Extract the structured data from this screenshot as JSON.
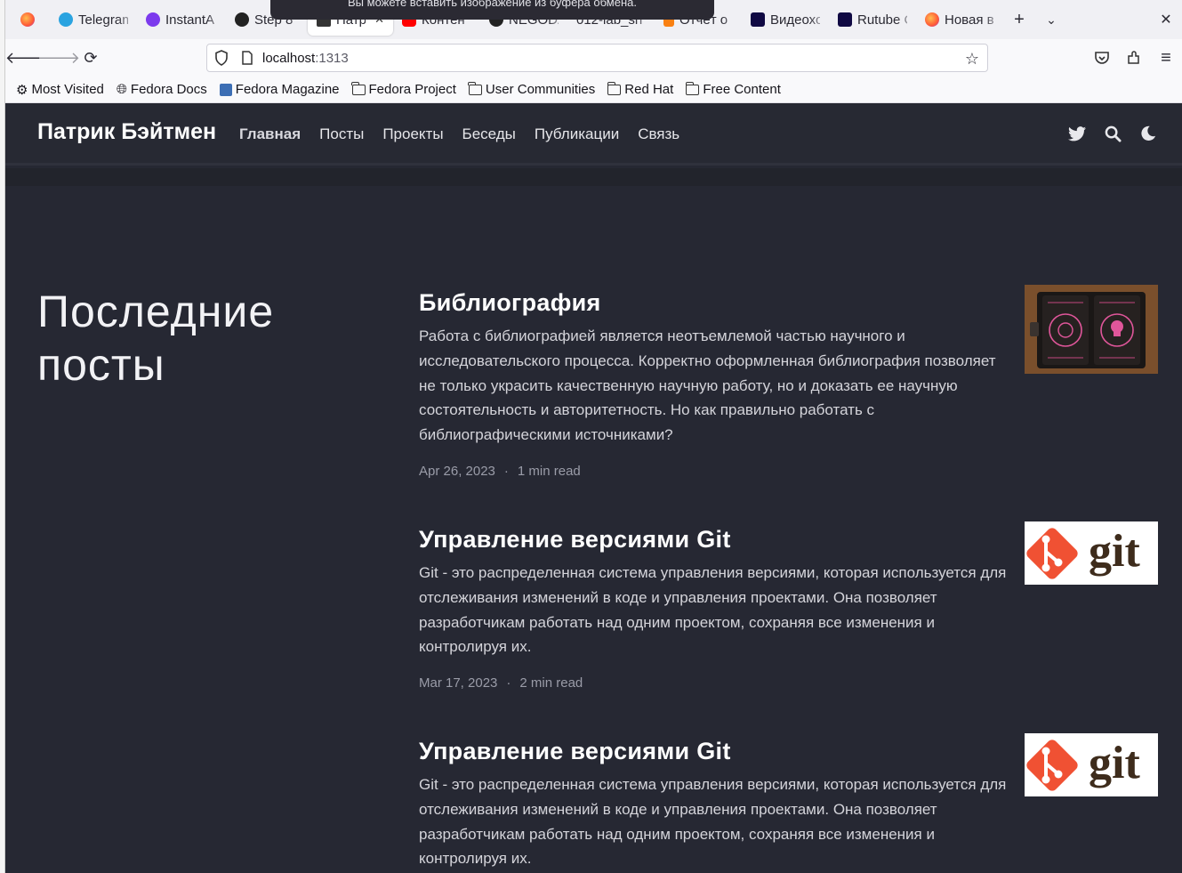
{
  "browser": {
    "tabs": [
      {
        "label": "",
        "icon": "firefox-icon"
      },
      {
        "label": "Telegram",
        "icon": "telegram-icon"
      },
      {
        "label": "InstantA",
        "icon": "instant-icon"
      },
      {
        "label": "Step 8",
        "icon": "step-icon"
      },
      {
        "label": "Патр",
        "icon": "page-icon",
        "active": true
      },
      {
        "label": "Контен",
        "icon": "youtube-icon"
      },
      {
        "label": "NEGODA",
        "icon": "github-icon"
      },
      {
        "label": "012-lab_sh",
        "icon": ""
      },
      {
        "label": "Отчёт о",
        "icon": "moodle-icon"
      },
      {
        "label": "Видеохо",
        "icon": "rutube-icon"
      },
      {
        "label": "Rutube С",
        "icon": "rutube-icon"
      },
      {
        "label": "Новая в",
        "icon": "firefox-icon"
      }
    ],
    "toast": "Вы можете вставить изображение из буфера обмена.",
    "url_host": "localhost",
    "url_port": ":1313",
    "bookmarks": [
      {
        "label": "Most Visited",
        "icon": "gear-icon"
      },
      {
        "label": "Fedora Docs",
        "icon": "globe-icon"
      },
      {
        "label": "Fedora Magazine",
        "icon": "fedora-magazine-icon"
      },
      {
        "label": "Fedora Project",
        "icon": "folder-icon"
      },
      {
        "label": "User Communities",
        "icon": "folder-icon"
      },
      {
        "label": "Red Hat",
        "icon": "folder-icon"
      },
      {
        "label": "Free Content",
        "icon": "folder-icon"
      }
    ]
  },
  "site": {
    "brand": "Патрик Бэйтмен",
    "menu": [
      "Главная",
      "Посты",
      "Проекты",
      "Беседы",
      "Публикации",
      "Связь"
    ],
    "active_menu": "Главная",
    "hero_title": "Последние посты",
    "posts": [
      {
        "title": "Библиография",
        "summary": "Работа с библиографией является неотъемлемой частью научного и исследовательского процесса. Корректно оформленная библиография позволяет не только украсить качественную научную работу, но и доказать ее научную состоятельность и авторитетность. Но как правильно работать с библиографическими источниками?",
        "date": "Apr 26, 2023",
        "read_time": "1 min read",
        "thumb": "book"
      },
      {
        "title": "Управление версиями Git",
        "summary": "Git - это распределенная система управления версиями, которая используется для отслеживания изменений в коде и управления проектами. Она позволяет разработчикам работать над одним проектом, сохраняя все изменения и контролируя их.",
        "date": "Mar 17, 2023",
        "read_time": "2 min read",
        "thumb": "git"
      },
      {
        "title": "Управление версиями Git",
        "summary": "Git - это распределенная система управления версиями, которая используется для отслеживания изменений в коде и управления проектами. Она позволяет разработчикам работать над одним проектом, сохраняя все изменения и контролируя их.",
        "thumb": "git"
      }
    ],
    "git_logo_text": "git"
  },
  "colors": {
    "site_bg": "#262833",
    "header_bg": "#272933",
    "git_orange": "#f05133",
    "git_text": "#3e2c1c"
  }
}
